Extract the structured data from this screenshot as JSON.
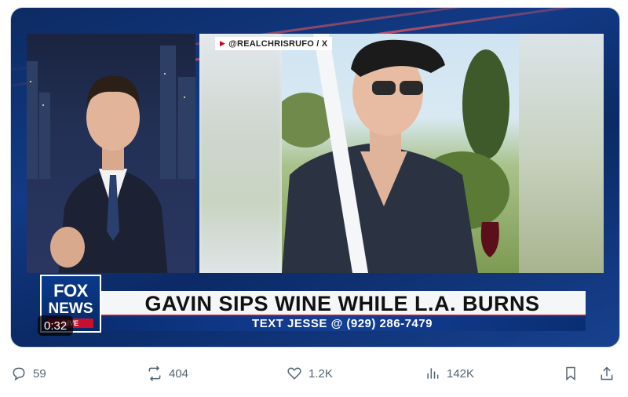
{
  "video": {
    "source_handle": "@REALCHRISRUFO / X",
    "headline": "GAVIN SIPS WINE WHILE L.A. BURNS",
    "subheadline": "TEXT JESSE @ (929) 286-7479",
    "logo_top": "FOX",
    "logo_middle": "NEWS",
    "logo_bottom": "LIVE",
    "timestamp": "0:32"
  },
  "actions": {
    "replies": "59",
    "reposts": "404",
    "likes": "1.2K",
    "views": "142K"
  },
  "icons": {
    "reply": "reply-icon",
    "repost": "repost-icon",
    "like": "heart-icon",
    "views": "views-icon",
    "bookmark": "bookmark-icon",
    "share": "share-icon"
  },
  "colors": {
    "fox_blue": "#0a2e73",
    "fox_red": "#c8102e",
    "action_gray": "#536471"
  }
}
